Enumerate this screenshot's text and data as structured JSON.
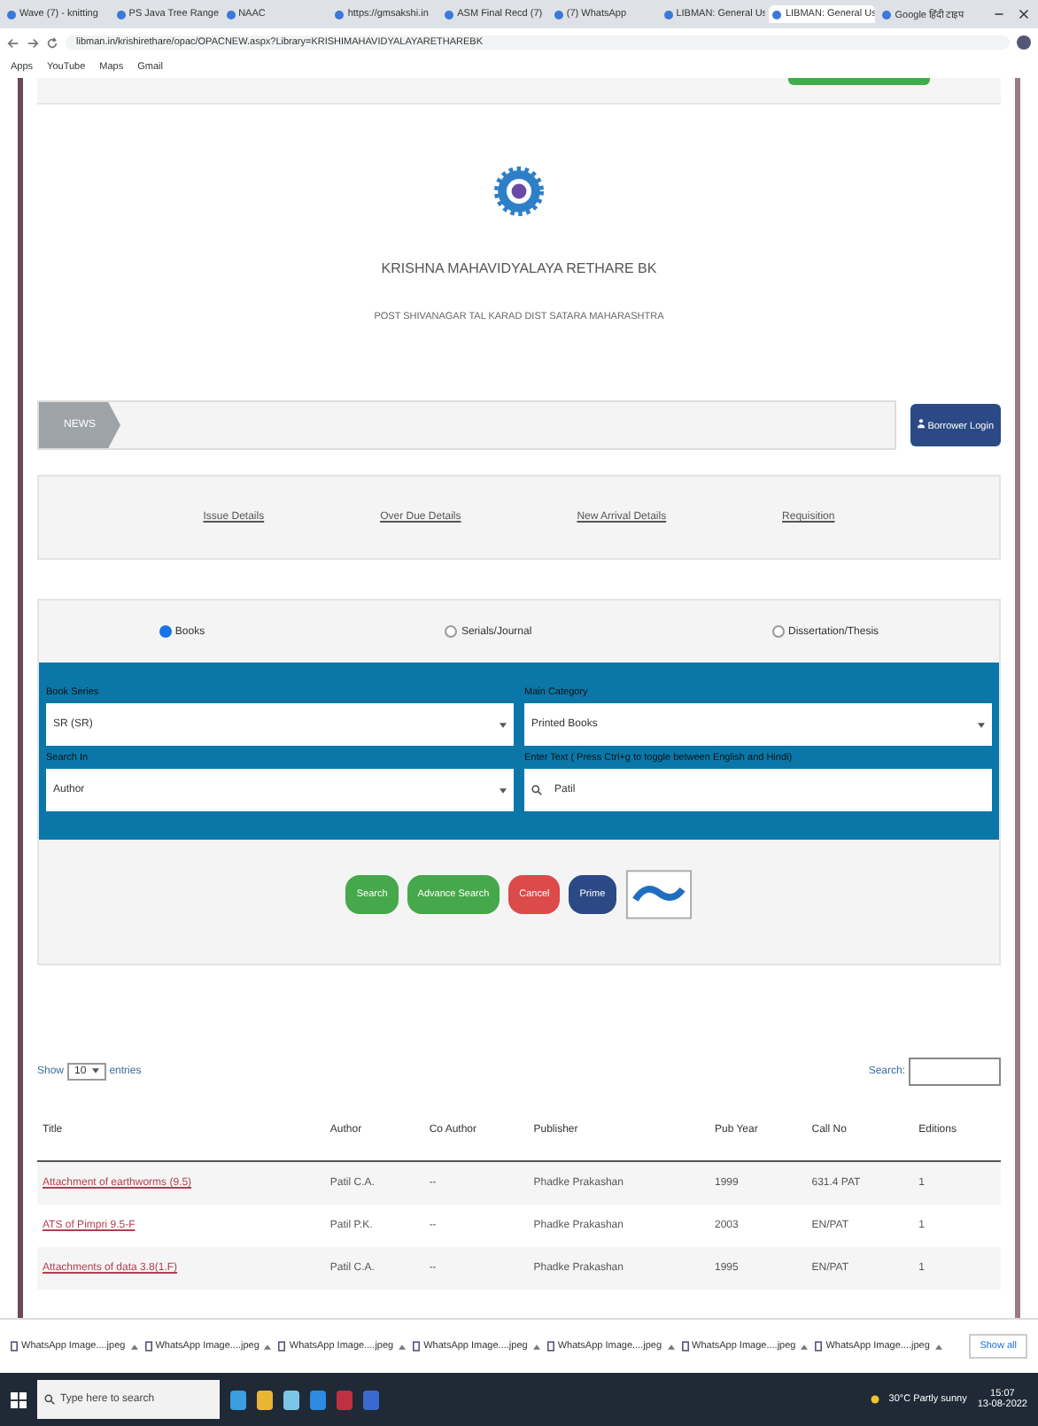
{
  "browser": {
    "tabs": [
      {
        "title": "Wave (7) - knitting",
        "selected": false
      },
      {
        "title": "PS Java Tree Range",
        "selected": false
      },
      {
        "title": "NAAC",
        "selected": false
      },
      {
        "title": "https://gmsakshi.in",
        "selected": false
      },
      {
        "title": "ASM Final Recd (7)",
        "selected": false
      },
      {
        "title": "(7) WhatsApp",
        "selected": false
      },
      {
        "title": "LIBMAN: General Us",
        "selected": false
      },
      {
        "title": "LIBMAN: General Us",
        "selected": true
      },
      {
        "title": "Google हिंदी टाइप",
        "selected": false
      }
    ],
    "url": "libman.in/krishirethare/opac/OPACNEW.aspx?Library=KRISHIMAHAVIDYALAYARETHAREBK",
    "bookmarks": [
      "Apps",
      "YouTube",
      "Maps",
      "Gmail"
    ]
  },
  "header": {
    "college": "KRISHNA MAHAVIDYALAYA RETHARE BK",
    "address": "POST SHIVANAGAR TAL KARAD DIST SATARA MAHARASHTRA"
  },
  "news": {
    "label": "NEWS",
    "login": "Borrower Login"
  },
  "links": [
    "Issue Details",
    "Over Due Details",
    "New Arrival Details",
    "Requisition"
  ],
  "material": [
    {
      "label": "Books",
      "selected": true
    },
    {
      "label": "Serials/Journal",
      "selected": false
    },
    {
      "label": "Dissertation/Thesis",
      "selected": false
    }
  ],
  "form": [
    {
      "label": "Book Series",
      "kind": "select",
      "value": "SR (SR)"
    },
    {
      "label": "Main Category",
      "kind": "select",
      "value": "Printed Books"
    },
    {
      "label": "Search In",
      "kind": "select",
      "value": "Author"
    },
    {
      "label": "Enter Text  ( Press Ctrl+g to toggle between English and Hindi)",
      "kind": "text",
      "value": "Patil"
    }
  ],
  "actions": [
    {
      "label": "Search",
      "kind": "ok"
    },
    {
      "label": "Advance Search",
      "kind": "ok"
    },
    {
      "label": "Cancel",
      "kind": "danger"
    },
    {
      "label": "Prime",
      "kind": "primary"
    }
  ],
  "table": {
    "show_before": "Show",
    "length": "10",
    "show_after": "entries",
    "search_label": "Search:",
    "columns": [
      "Title",
      "Author",
      "Co Author",
      "Publisher",
      "Pub Year",
      "Call No",
      "Editions"
    ],
    "rows": [
      [
        "Attachment of earthworms (9.5)",
        "Patil C.A.",
        "--",
        "Phadke Prakashan",
        "1999",
        "631.4 PAT",
        "1"
      ],
      [
        "ATS of Pimpri 9.5-F",
        "Patil P.K.",
        "--",
        "Phadke Prakashan",
        "2003",
        "EN/PAT",
        "1"
      ],
      [
        "Attachments of data 3.8(1.F)",
        "Patil C.A.",
        "--",
        "Phadke Prakashan",
        "1995",
        "EN/PAT",
        "1"
      ]
    ]
  },
  "downloads": {
    "files": [
      "WhatsApp Image....jpeg",
      "WhatsApp Image....jpeg",
      "WhatsApp Image....jpeg",
      "WhatsApp Image....jpeg",
      "WhatsApp Image....jpeg",
      "WhatsApp Image....jpeg",
      "WhatsApp Image....jpeg"
    ],
    "show_all": "Show all"
  },
  "taskbar": {
    "search_placeholder": "Type here to search",
    "weather": "30°C Partly sunny",
    "time": "15:07",
    "date": "13-08-2022"
  }
}
